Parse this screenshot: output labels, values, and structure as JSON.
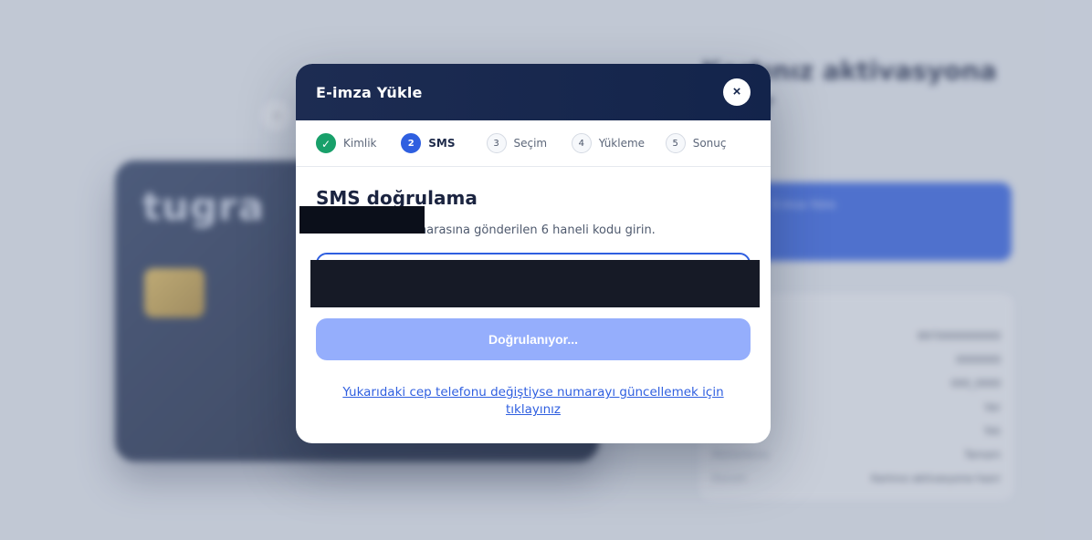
{
  "background": {
    "brand": "tugra",
    "title": "Kartınız aktivasyona hazır",
    "blue_box_title": "E-imza Yükle",
    "panel_rows": [
      {
        "key": "",
        "value": "8970000000000"
      },
      {
        "key": "",
        "value": "0000000"
      },
      {
        "key": "",
        "value": "000_0000"
      },
      {
        "key": "",
        "value": "Var"
      },
      {
        "key": "",
        "value": "Yok"
      },
      {
        "key": "Mühürleme",
        "value": "Tamam"
      },
      {
        "key": "Durum",
        "value": "Kartınız aktivasyona hazır"
      }
    ]
  },
  "modal": {
    "title": "E-imza Yükle",
    "close_glyph": "×",
    "steps": [
      {
        "number": "✓",
        "label": "Kimlik",
        "state": "done"
      },
      {
        "number": "2",
        "label": "SMS",
        "state": "active"
      },
      {
        "number": "3",
        "label": "Seçim",
        "state": "pending"
      },
      {
        "number": "4",
        "label": "Yükleme",
        "state": "pending"
      },
      {
        "number": "5",
        "label": "Sonuç",
        "state": "pending"
      }
    ],
    "heading": "SMS doğrulama",
    "description": "numarasına gönderilen 6 haneli kodu girin.",
    "code_value": "",
    "verify_button": "Doğrulanıyor...",
    "update_link": "Yukarıdaki cep telefonu değiştiyse numarayı güncellemek için tıklayınız"
  },
  "colors": {
    "header_bg": "#1d2c52",
    "accent": "#2f5fe0",
    "success": "#18a06a",
    "button_disabled": "#95aefc"
  }
}
